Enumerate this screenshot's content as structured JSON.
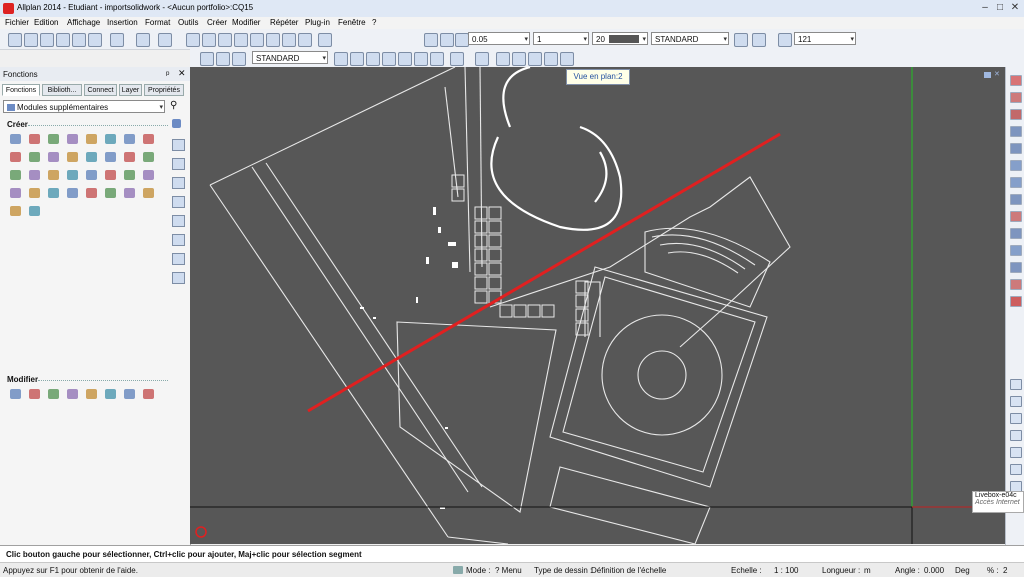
{
  "window": {
    "title": "Allplan 2014 - Etudiant - importsolidwork - <Aucun portfolio>:CQ15"
  },
  "menu": [
    "Fichier",
    "Edition",
    "Affichage",
    "Insertion",
    "Format",
    "Outils",
    "Créer",
    "Modifier",
    "Répéter",
    "Plug-in",
    "Fenêtre",
    "?"
  ],
  "toolbar": {
    "pen_thickness": "0.05",
    "line_type": "1",
    "color_number": "20",
    "layer_standard": "STANDARD",
    "scale_value": "121",
    "format_standard": "STANDARD"
  },
  "panel": {
    "title": "Fonctions",
    "tabs": [
      "Fonctions",
      "Biblioth...",
      "Connect",
      "Layer",
      "Propriétés"
    ],
    "module": "Modules supplémentaires",
    "section_create": "Créer",
    "section_modify": "Modifier"
  },
  "view": {
    "tooltip": "Vue en plan:2"
  },
  "network_tooltip": {
    "name": "Livebox-e04c",
    "status": "Accès Internet"
  },
  "prompt": "Clic bouton gauche pour sélectionner, Ctrl+clic pour ajouter, Maj+clic pour sélection segment",
  "status": {
    "help": "Appuyez sur F1 pour obtenir de l'aide.",
    "mode_label": "Mode :",
    "mode_value": "? Menu",
    "drawing_type_label": "Type de dessin :",
    "drawing_type_value": "Définition de l'échelle",
    "scale_label": "Echelle :",
    "scale_value": "1 : 100",
    "length_label": "Longueur :",
    "length_unit": "m",
    "angle_label": "Angle :",
    "angle_value": "0.000",
    "angle_unit": "Deg",
    "percent_label": "% :",
    "percent_value": "2"
  },
  "colors": {
    "canvas": "#575757",
    "red_line": "#e02020",
    "green_axis": "#20c020"
  }
}
